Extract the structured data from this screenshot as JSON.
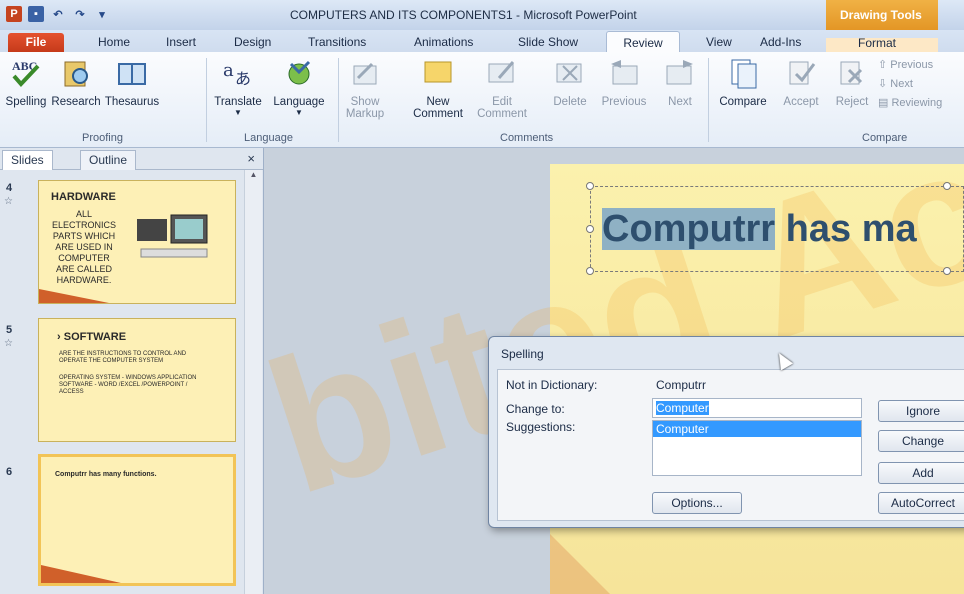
{
  "window": {
    "title": "COMPUTERS AND ITS COMPONENTS1  -  Microsoft PowerPoint",
    "contextual_tab": "Drawing Tools"
  },
  "tabs": {
    "file": "File",
    "home": "Home",
    "insert": "Insert",
    "design": "Design",
    "transitions": "Transitions",
    "animations": "Animations",
    "slideshow": "Slide Show",
    "review": "Review",
    "view": "View",
    "addins": "Add-Ins",
    "format": "Format"
  },
  "ribbon": {
    "proofing": {
      "label": "Proofing",
      "spelling": "Spelling",
      "research": "Research",
      "thesaurus": "Thesaurus"
    },
    "language": {
      "label": "Language",
      "translate": "Translate",
      "language": "Language"
    },
    "comments": {
      "label": "Comments",
      "show_markup": "Show Markup",
      "new_comment": "New Comment",
      "edit_comment": "Edit Comment",
      "delete": "Delete",
      "previous": "Previous",
      "next": "Next"
    },
    "compare": {
      "label": "Compare",
      "compare": "Compare",
      "accept": "Accept",
      "reject": "Reject",
      "previous": "Previous",
      "next": "Next",
      "reviewing": "Reviewing"
    }
  },
  "panel": {
    "tab_slides": "Slides",
    "tab_outline": "Outline",
    "close": "×"
  },
  "thumbnails": [
    {
      "num": "4",
      "title": "HARDWARE",
      "body": "ALL ELECTRONICS PARTS WHICH ARE USED IN COMPUTER ARE CALLED HARDWARE."
    },
    {
      "num": "5",
      "title": "SOFTWARE",
      "body1": "ARE THE INSTRUCTIONS TO CONTROL AND OPERATE THE COMPUTER SYSTEM",
      "body2": "OPERATING SYSTEM - WINDOWS APPLICATION SOFTWARE - WORD /EXCEL /POWERPOINT / ACCESS"
    },
    {
      "num": "6",
      "title": "Computrr has many functions."
    }
  ],
  "slide": {
    "title_misspelled": "Computrr",
    "title_rest": " has ma"
  },
  "spelling_dialog": {
    "title": "Spelling",
    "not_in_dictionary_label": "Not in Dictionary:",
    "not_in_dictionary_value": "Computrr",
    "change_to_label": "Change to:",
    "change_to_value": "Computer",
    "suggestions_label": "Suggestions:",
    "suggestions": [
      "Computer"
    ],
    "ignore": "Ignore",
    "change": "Change",
    "add": "Add",
    "options": "Options...",
    "autocorrect": "AutoCorrect"
  },
  "colors": {
    "accent": "#e08f1d",
    "file_tab": "#c53a1a",
    "slide_bg": "#fbf1ad",
    "title_text": "#2e4f6e",
    "selection": "#3399ff"
  }
}
